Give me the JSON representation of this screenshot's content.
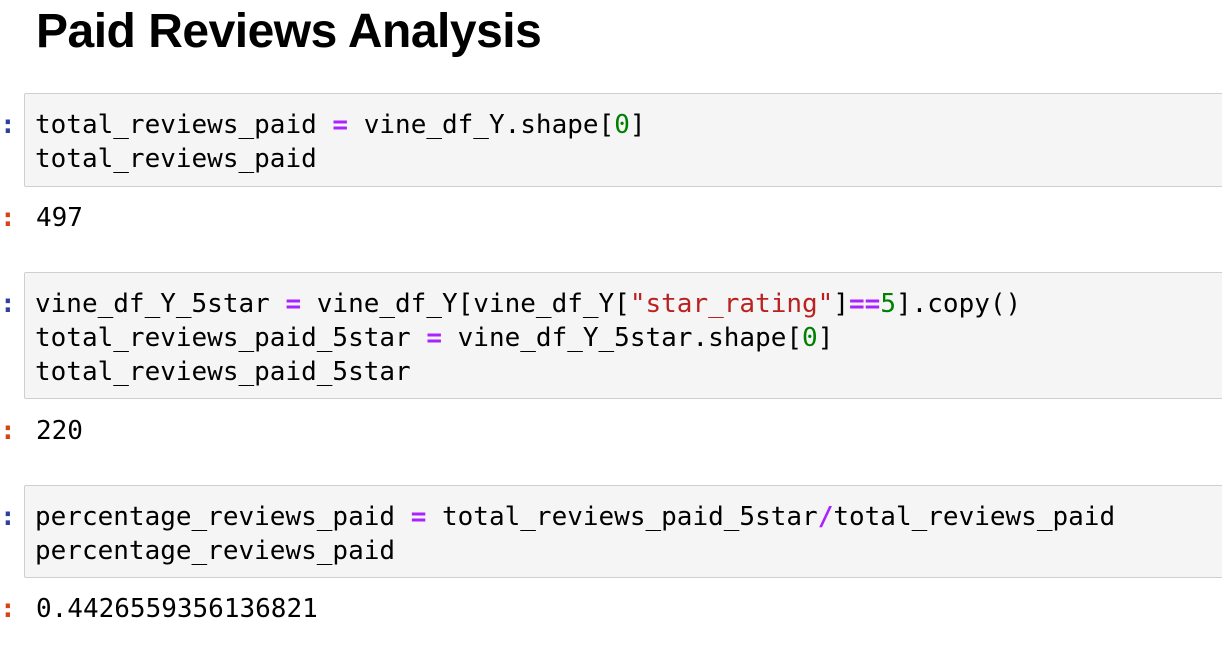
{
  "heading": "Paid Reviews Analysis",
  "colors": {
    "operator": "#aa22ff",
    "number": "#008000",
    "string": "#ba2121",
    "input_prompt": "#303f9f",
    "output_prompt": "#d84315",
    "cell_background": "#f5f5f5"
  },
  "cells": [
    {
      "input_prompt": ":",
      "output_prompt": ":",
      "lines": [
        [
          {
            "type": "plain",
            "text": "total_reviews_paid "
          },
          {
            "type": "op",
            "text": "="
          },
          {
            "type": "plain",
            "text": " vine_df_Y.shape["
          },
          {
            "type": "num",
            "text": "0"
          },
          {
            "type": "plain",
            "text": "]"
          }
        ],
        [
          {
            "type": "plain",
            "text": "total_reviews_paid"
          }
        ]
      ],
      "output": "497"
    },
    {
      "input_prompt": ":",
      "output_prompt": ":",
      "lines": [
        [
          {
            "type": "plain",
            "text": "vine_df_Y_5star "
          },
          {
            "type": "op",
            "text": "="
          },
          {
            "type": "plain",
            "text": " vine_df_Y[vine_df_Y["
          },
          {
            "type": "str",
            "text": "\"star_rating\""
          },
          {
            "type": "plain",
            "text": "]"
          },
          {
            "type": "op",
            "text": "=="
          },
          {
            "type": "num",
            "text": "5"
          },
          {
            "type": "plain",
            "text": "].copy()"
          }
        ],
        [
          {
            "type": "plain",
            "text": "total_reviews_paid_5star "
          },
          {
            "type": "op",
            "text": "="
          },
          {
            "type": "plain",
            "text": " vine_df_Y_5star.shape["
          },
          {
            "type": "num",
            "text": "0"
          },
          {
            "type": "plain",
            "text": "]"
          }
        ],
        [
          {
            "type": "plain",
            "text": "total_reviews_paid_5star"
          }
        ]
      ],
      "output": "220"
    },
    {
      "input_prompt": ":",
      "output_prompt": ":",
      "lines": [
        [
          {
            "type": "plain",
            "text": "percentage_reviews_paid "
          },
          {
            "type": "op",
            "text": "="
          },
          {
            "type": "plain",
            "text": " total_reviews_paid_5star"
          },
          {
            "type": "op",
            "text": "/"
          },
          {
            "type": "plain",
            "text": "total_reviews_paid"
          }
        ],
        [
          {
            "type": "plain",
            "text": "percentage_reviews_paid"
          }
        ]
      ],
      "output": "0.4426559356136821"
    }
  ]
}
